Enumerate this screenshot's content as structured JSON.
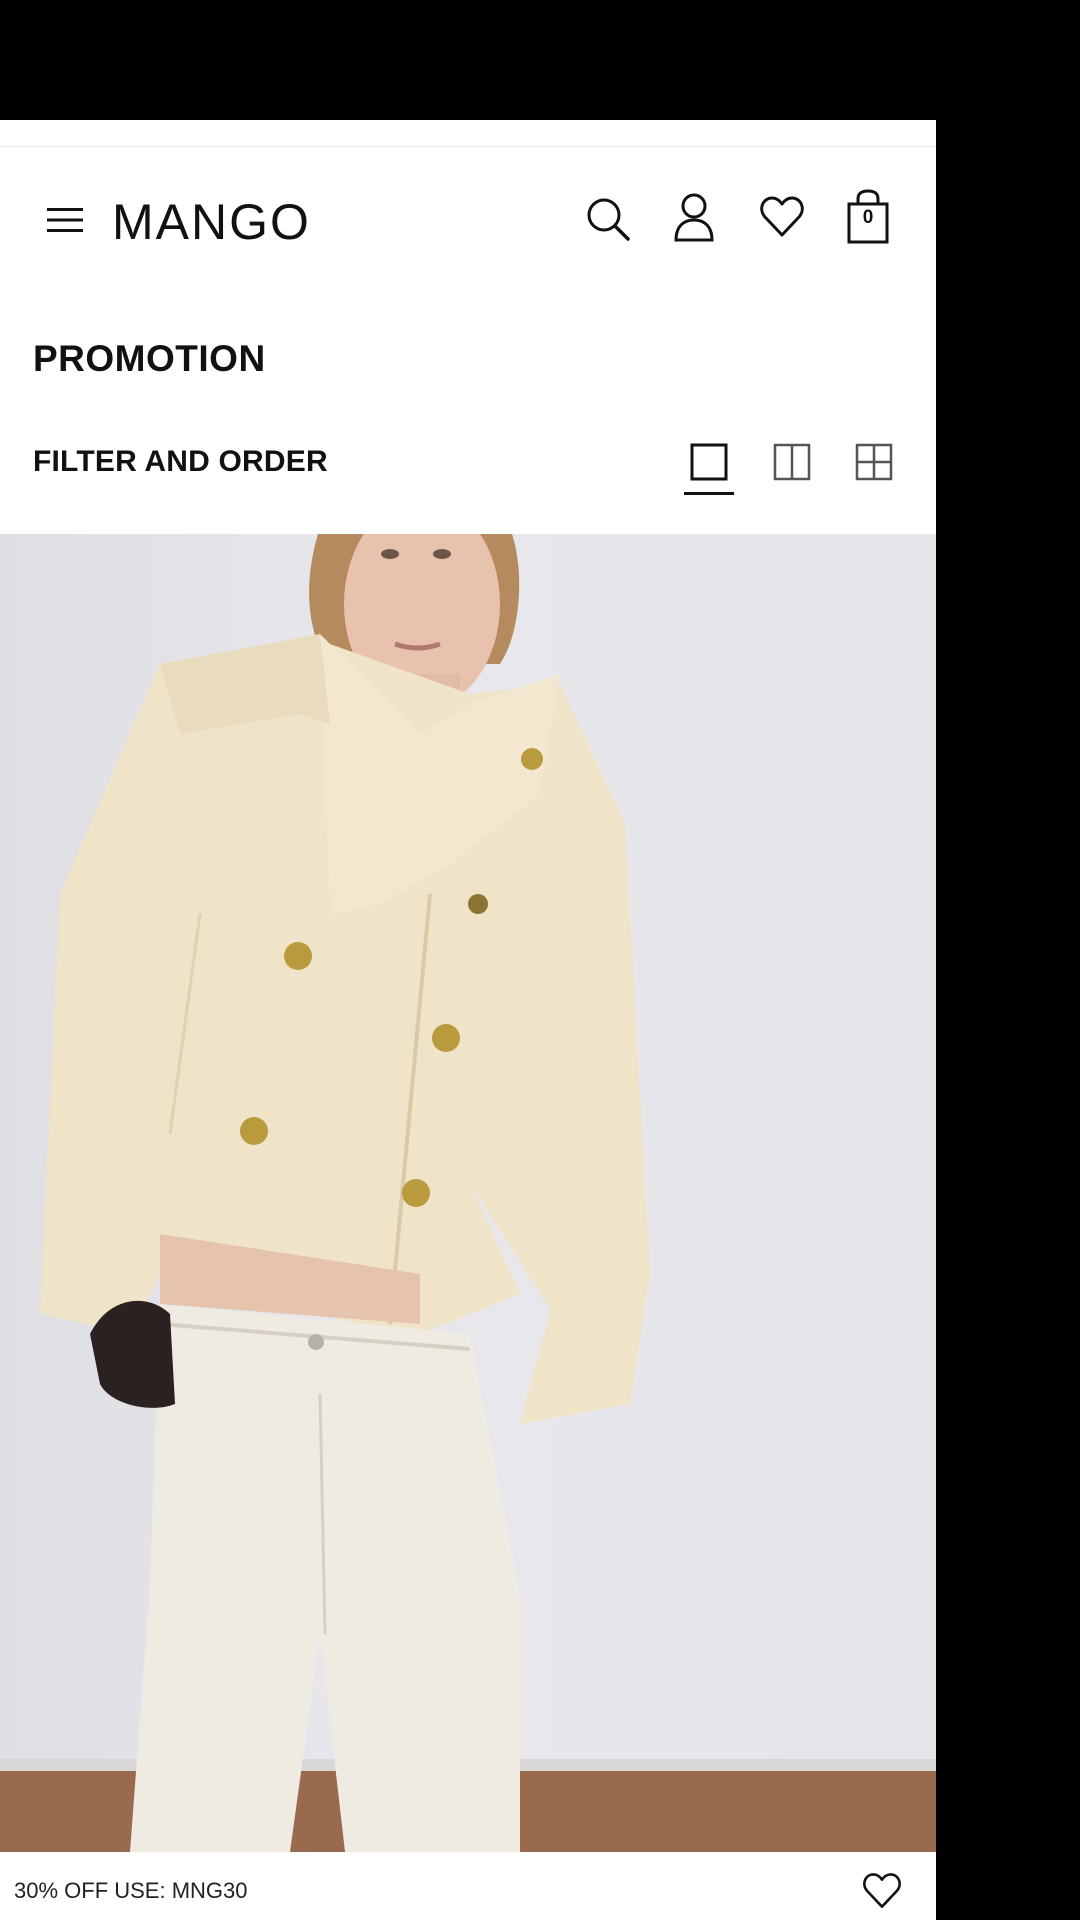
{
  "header": {
    "brand": "MANGO",
    "bag_count": "0",
    "icons": [
      "menu-icon",
      "search-icon",
      "user-icon",
      "heart-icon",
      "shopping-bag-icon"
    ]
  },
  "page": {
    "title": "PROMOTION",
    "filter_label": "FILTER AND ORDER",
    "view_modes": [
      "single-column",
      "two-column",
      "four-grid"
    ],
    "selected_view": "single-column"
  },
  "product": {
    "promo_text": "30% OFF USE: MNG30"
  },
  "colors": {
    "accent": "#111111",
    "background": "#ffffff",
    "image_bg": "#e6e6ea",
    "coat": "#efe3c8",
    "pants": "#efebe2"
  }
}
